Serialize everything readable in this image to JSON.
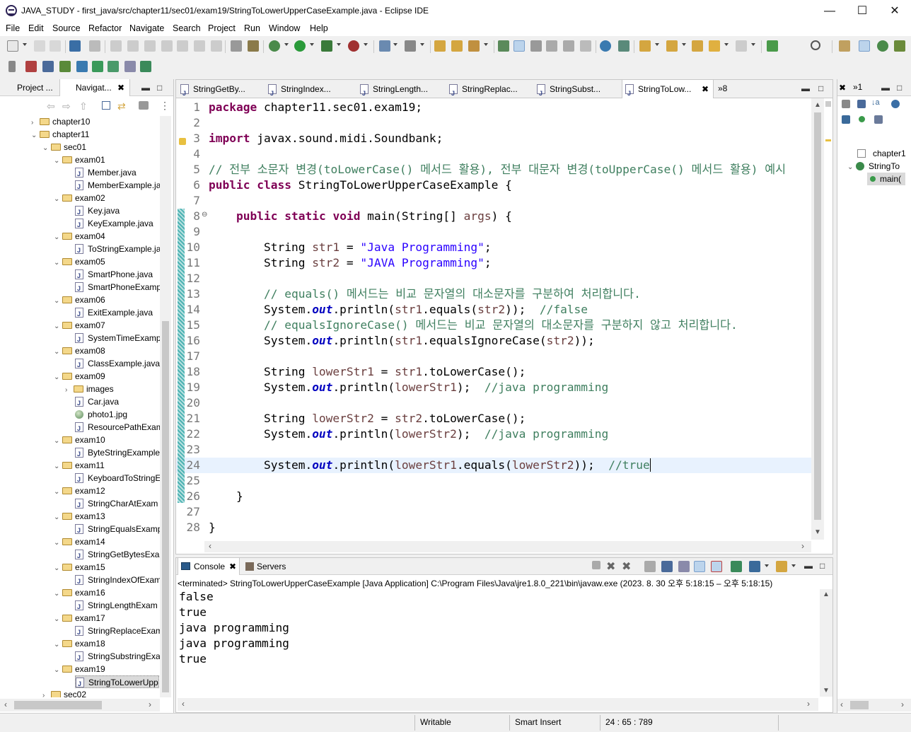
{
  "window": {
    "title": "JAVA_STUDY - first_java/src/chapter11/sec01/exam19/StringToLowerUpperCaseExample.java - Eclipse IDE"
  },
  "menu": [
    "File",
    "Edit",
    "Source",
    "Refactor",
    "Navigate",
    "Search",
    "Project",
    "Run",
    "Window",
    "Help"
  ],
  "left_panel": {
    "tabs": [
      "Project ...",
      "Navigat..."
    ],
    "tree": [
      {
        "label": "chapter10",
        "type": "folder",
        "indent": 0,
        "expanded": false
      },
      {
        "label": "chapter11",
        "type": "folder",
        "indent": 0,
        "expanded": true
      },
      {
        "label": "sec01",
        "type": "folder",
        "indent": 1,
        "expanded": true
      },
      {
        "label": "exam01",
        "type": "folder",
        "indent": 2,
        "expanded": true
      },
      {
        "label": "Member.java",
        "type": "java",
        "indent": 3
      },
      {
        "label": "MemberExample.ja",
        "type": "java",
        "indent": 3
      },
      {
        "label": "exam02",
        "type": "folder",
        "indent": 2,
        "expanded": true
      },
      {
        "label": "Key.java",
        "type": "java",
        "indent": 3
      },
      {
        "label": "KeyExample.java",
        "type": "java",
        "indent": 3
      },
      {
        "label": "exam04",
        "type": "folder",
        "indent": 2,
        "expanded": true
      },
      {
        "label": "ToStringExample.ja",
        "type": "java",
        "indent": 3
      },
      {
        "label": "exam05",
        "type": "folder",
        "indent": 2,
        "expanded": true
      },
      {
        "label": "SmartPhone.java",
        "type": "java",
        "indent": 3
      },
      {
        "label": "SmartPhoneExamp",
        "type": "java",
        "indent": 3
      },
      {
        "label": "exam06",
        "type": "folder",
        "indent": 2,
        "expanded": true
      },
      {
        "label": "ExitExample.java",
        "type": "java",
        "indent": 3
      },
      {
        "label": "exam07",
        "type": "folder",
        "indent": 2,
        "expanded": true
      },
      {
        "label": "SystemTimeExamp",
        "type": "java",
        "indent": 3
      },
      {
        "label": "exam08",
        "type": "folder",
        "indent": 2,
        "expanded": true
      },
      {
        "label": "ClassExample.java",
        "type": "java",
        "indent": 3
      },
      {
        "label": "exam09",
        "type": "folder",
        "indent": 2,
        "expanded": true
      },
      {
        "label": "images",
        "type": "folder",
        "indent": 3,
        "expanded": false
      },
      {
        "label": "Car.java",
        "type": "java",
        "indent": 3
      },
      {
        "label": "photo1.jpg",
        "type": "image",
        "indent": 3
      },
      {
        "label": "ResourcePathExam",
        "type": "java",
        "indent": 3
      },
      {
        "label": "exam10",
        "type": "folder",
        "indent": 2,
        "expanded": true
      },
      {
        "label": "ByteStringExample",
        "type": "java",
        "indent": 3
      },
      {
        "label": "exam11",
        "type": "folder",
        "indent": 2,
        "expanded": true
      },
      {
        "label": "KeyboardToStringE",
        "type": "java",
        "indent": 3
      },
      {
        "label": "exam12",
        "type": "folder",
        "indent": 2,
        "expanded": true
      },
      {
        "label": "StringCharAtExam",
        "type": "java",
        "indent": 3
      },
      {
        "label": "exam13",
        "type": "folder",
        "indent": 2,
        "expanded": true
      },
      {
        "label": "StringEqualsExamp",
        "type": "java",
        "indent": 3
      },
      {
        "label": "exam14",
        "type": "folder",
        "indent": 2,
        "expanded": true
      },
      {
        "label": "StringGetBytesExar",
        "type": "java",
        "indent": 3
      },
      {
        "label": "exam15",
        "type": "folder",
        "indent": 2,
        "expanded": true
      },
      {
        "label": "StringIndexOfExam",
        "type": "java",
        "indent": 3
      },
      {
        "label": "exam16",
        "type": "folder",
        "indent": 2,
        "expanded": true
      },
      {
        "label": "StringLengthExam",
        "type": "java",
        "indent": 3
      },
      {
        "label": "exam17",
        "type": "folder",
        "indent": 2,
        "expanded": true
      },
      {
        "label": "StringReplaceExam",
        "type": "java",
        "indent": 3
      },
      {
        "label": "exam18",
        "type": "folder",
        "indent": 2,
        "expanded": true
      },
      {
        "label": "StringSubstringExa",
        "type": "java",
        "indent": 3
      },
      {
        "label": "exam19",
        "type": "folder",
        "indent": 2,
        "expanded": true
      },
      {
        "label": "StringToLowerUpp",
        "type": "java",
        "indent": 3,
        "selected": true
      },
      {
        "label": "sec02",
        "type": "folder",
        "indent": 1,
        "expanded": false
      }
    ]
  },
  "editor": {
    "tabs": [
      {
        "label": "StringGetBy...",
        "active": false
      },
      {
        "label": "StringIndex...",
        "active": false
      },
      {
        "label": "StringLength...",
        "active": false
      },
      {
        "label": "StringReplac...",
        "active": false
      },
      {
        "label": "StringSubst...",
        "active": false
      },
      {
        "label": "StringToLow...",
        "active": true
      }
    ],
    "overflow_label": "»8",
    "current_line": 24,
    "lines": [
      {
        "n": "1",
        "tokens": [
          [
            "kw",
            "package"
          ],
          [
            "p",
            " chapter11.sec01.exam19;"
          ]
        ]
      },
      {
        "n": "2",
        "tokens": []
      },
      {
        "n": "3",
        "tokens": [
          [
            "kw",
            "import"
          ],
          [
            "p",
            " javax.sound.midi.Soundbank;"
          ]
        ]
      },
      {
        "n": "4",
        "tokens": []
      },
      {
        "n": "5",
        "tokens": [
          [
            "cm",
            "// 전부 소문자 변경(toLowerCase() 메서드 활용), 전부 대문자 변경(toUpperCase() 메서드 활용) 예시"
          ]
        ]
      },
      {
        "n": "6",
        "tokens": [
          [
            "kw",
            "public"
          ],
          [
            "p",
            " "
          ],
          [
            "kw",
            "class"
          ],
          [
            "p",
            " StringToLowerUpperCaseExample {"
          ]
        ]
      },
      {
        "n": "7",
        "tokens": []
      },
      {
        "n": "8",
        "tokens": [
          [
            "p",
            "    "
          ],
          [
            "kw",
            "public"
          ],
          [
            "p",
            " "
          ],
          [
            "kw",
            "static"
          ],
          [
            "p",
            " "
          ],
          [
            "kw",
            "void"
          ],
          [
            "p",
            " main(String[] "
          ],
          [
            "var",
            "args"
          ],
          [
            "p",
            ") {"
          ]
        ]
      },
      {
        "n": "9",
        "tokens": []
      },
      {
        "n": "10",
        "tokens": [
          [
            "p",
            "        String "
          ],
          [
            "var",
            "str1"
          ],
          [
            "p",
            " = "
          ],
          [
            "st",
            "\"Java Programming\""
          ],
          [
            "p",
            ";"
          ]
        ]
      },
      {
        "n": "11",
        "tokens": [
          [
            "p",
            "        String "
          ],
          [
            "var",
            "str2"
          ],
          [
            "p",
            " = "
          ],
          [
            "st",
            "\"JAVA Programming\""
          ],
          [
            "p",
            ";"
          ]
        ]
      },
      {
        "n": "12",
        "tokens": []
      },
      {
        "n": "13",
        "tokens": [
          [
            "p",
            "        "
          ],
          [
            "cm",
            "// equals() 메서드는 비교 문자열의 대소문자를 구분하여 처리합니다."
          ]
        ]
      },
      {
        "n": "14",
        "tokens": [
          [
            "p",
            "        System."
          ],
          [
            "fld",
            "out"
          ],
          [
            "p",
            ".println("
          ],
          [
            "var",
            "str1"
          ],
          [
            "p",
            ".equals("
          ],
          [
            "var",
            "str2"
          ],
          [
            "p",
            "));  "
          ],
          [
            "cm",
            "//false"
          ]
        ]
      },
      {
        "n": "15",
        "tokens": [
          [
            "p",
            "        "
          ],
          [
            "cm",
            "// equalsIgnoreCase() 메서드는 비교 문자열의 대소문자를 구분하지 않고 처리합니다."
          ]
        ]
      },
      {
        "n": "16",
        "tokens": [
          [
            "p",
            "        System."
          ],
          [
            "fld",
            "out"
          ],
          [
            "p",
            ".println("
          ],
          [
            "var",
            "str1"
          ],
          [
            "p",
            ".equalsIgnoreCase("
          ],
          [
            "var",
            "str2"
          ],
          [
            "p",
            "));"
          ]
        ]
      },
      {
        "n": "17",
        "tokens": []
      },
      {
        "n": "18",
        "tokens": [
          [
            "p",
            "        String "
          ],
          [
            "var",
            "lowerStr1"
          ],
          [
            "p",
            " = "
          ],
          [
            "var",
            "str1"
          ],
          [
            "p",
            ".toLowerCase();"
          ]
        ]
      },
      {
        "n": "19",
        "tokens": [
          [
            "p",
            "        System."
          ],
          [
            "fld",
            "out"
          ],
          [
            "p",
            ".println("
          ],
          [
            "var",
            "lowerStr1"
          ],
          [
            "p",
            ");  "
          ],
          [
            "cm",
            "//java programming"
          ]
        ]
      },
      {
        "n": "20",
        "tokens": []
      },
      {
        "n": "21",
        "tokens": [
          [
            "p",
            "        String "
          ],
          [
            "var",
            "lowerStr2"
          ],
          [
            "p",
            " = "
          ],
          [
            "var",
            "str2"
          ],
          [
            "p",
            ".toLowerCase();"
          ]
        ]
      },
      {
        "n": "22",
        "tokens": [
          [
            "p",
            "        System."
          ],
          [
            "fld",
            "out"
          ],
          [
            "p",
            ".println("
          ],
          [
            "var",
            "lowerStr2"
          ],
          [
            "p",
            ");  "
          ],
          [
            "cm",
            "//java programming"
          ]
        ]
      },
      {
        "n": "23",
        "tokens": []
      },
      {
        "n": "24",
        "tokens": [
          [
            "p",
            "        System."
          ],
          [
            "fld",
            "out"
          ],
          [
            "p",
            ".println("
          ],
          [
            "var",
            "lowerStr1"
          ],
          [
            "p",
            ".equals("
          ],
          [
            "var",
            "lowerStr2"
          ],
          [
            "p",
            "));  "
          ],
          [
            "cm",
            "//true"
          ]
        ]
      },
      {
        "n": "25",
        "tokens": []
      },
      {
        "n": "26",
        "tokens": [
          [
            "p",
            "    }"
          ]
        ]
      },
      {
        "n": "27",
        "tokens": []
      },
      {
        "n": "28",
        "tokens": [
          [
            "p",
            "}"
          ]
        ]
      }
    ]
  },
  "console": {
    "tabs": [
      "Console",
      "Servers"
    ],
    "header": "<terminated> StringToLowerUpperCaseExample [Java Application] C:\\Program Files\\Java\\jre1.8.0_221\\bin\\javaw.exe  (2023. 8. 30 오후 5:18:15 – 오후 5:18:15)",
    "output": [
      "false",
      "true",
      "java programming",
      "java programming",
      "true"
    ]
  },
  "outline": {
    "items": [
      "chapter1",
      "StringTo",
      "main("
    ]
  },
  "status": {
    "writable": "Writable",
    "insert_mode": "Smart Insert",
    "position": "24 : 65 : 789"
  },
  "colors": {
    "keyword": "#7f0055",
    "comment": "#3f7f5f",
    "string": "#2a00ff",
    "field": "#0000c0",
    "variable": "#6a3e3e",
    "current_line": "#e8f2fe"
  }
}
